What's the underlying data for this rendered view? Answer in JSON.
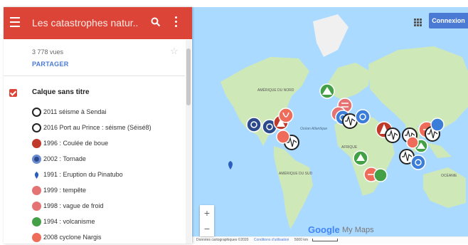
{
  "header": {
    "title": "Les catastrophes natur...",
    "menu_icon": "hamburger-menu-icon",
    "search_icon": "search-icon",
    "more_icon": "more-vertical-icon",
    "color": "#db4437"
  },
  "panel": {
    "views": "3 778 vues",
    "share_label": "PARTAGER",
    "layer_title": "Calque sans titre",
    "items": [
      {
        "label": "2011 séisme à Sendai",
        "icon": "seismograph-icon",
        "color": "#222222"
      },
      {
        "label": "2016 Port au Prince : séisme (Séisé8)",
        "icon": "seismograph-icon",
        "color": "#222222"
      },
      {
        "label": "1996 : Coulée de boue",
        "icon": "landslide-icon",
        "color": "#c0392b"
      },
      {
        "label": "2002 : Tornade",
        "icon": "tornado-icon",
        "color": "#2c4a8c"
      },
      {
        "label": "1991 : Eruption du Pinatubo",
        "icon": "pin-icon",
        "color": "#2b5fbd"
      },
      {
        "label": "1999 : tempête",
        "icon": "wind-icon",
        "color": "#e57373"
      },
      {
        "label": "1998 : vague de froid",
        "icon": "snowflake-icon",
        "color": "#e57373"
      },
      {
        "label": "1994 : volcanisme",
        "icon": "volcano-icon",
        "color": "#43a047"
      },
      {
        "label": "2008 cyclone Nargis",
        "icon": "cyclone-icon",
        "color": "#ef6c5b"
      }
    ]
  },
  "map": {
    "connexion_label": "Connexion",
    "apps_icon": "apps-grid-icon",
    "zoom_in": "+",
    "zoom_out": "−",
    "brand_google": "Google",
    "brand_mymaps": "My Maps",
    "footer_data": "Données cartographiques ©2020",
    "footer_terms": "Conditions d'utilisation",
    "footer_scale": "5000 km",
    "labels": {
      "north_america": "AMÉRIQUE DU NORD",
      "south_america": "AMÉRIQUE DU SUD",
      "africa": "AFRIQUE",
      "oceania": "OCÉANIE",
      "atlantic": "Océan Atlantique"
    },
    "ocean_color": "#aadaff",
    "land_color": "#cfe8b8"
  }
}
